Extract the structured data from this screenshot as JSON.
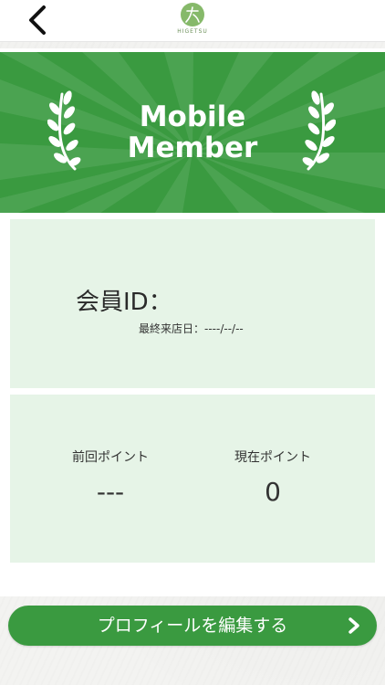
{
  "header": {
    "logo_text": "HIGETSU"
  },
  "banner": {
    "title_line1": "Mobile",
    "title_line2": "Member"
  },
  "member": {
    "id_label": "会員ID：",
    "last_visit": "最終来店日：----/--/--"
  },
  "points": {
    "previous_label": "前回ポイント",
    "previous_value": "---",
    "current_label": "現在ポイント",
    "current_value": "0"
  },
  "actions": {
    "edit_profile_label": "プロフィールを編集する"
  },
  "colors": {
    "brand_green": "#3a9a40",
    "panel_green": "#e6f4e7"
  },
  "icons": {
    "back": "back-arrow-icon",
    "next": "chevron-right-icon",
    "laurel": "laurel-icon"
  }
}
